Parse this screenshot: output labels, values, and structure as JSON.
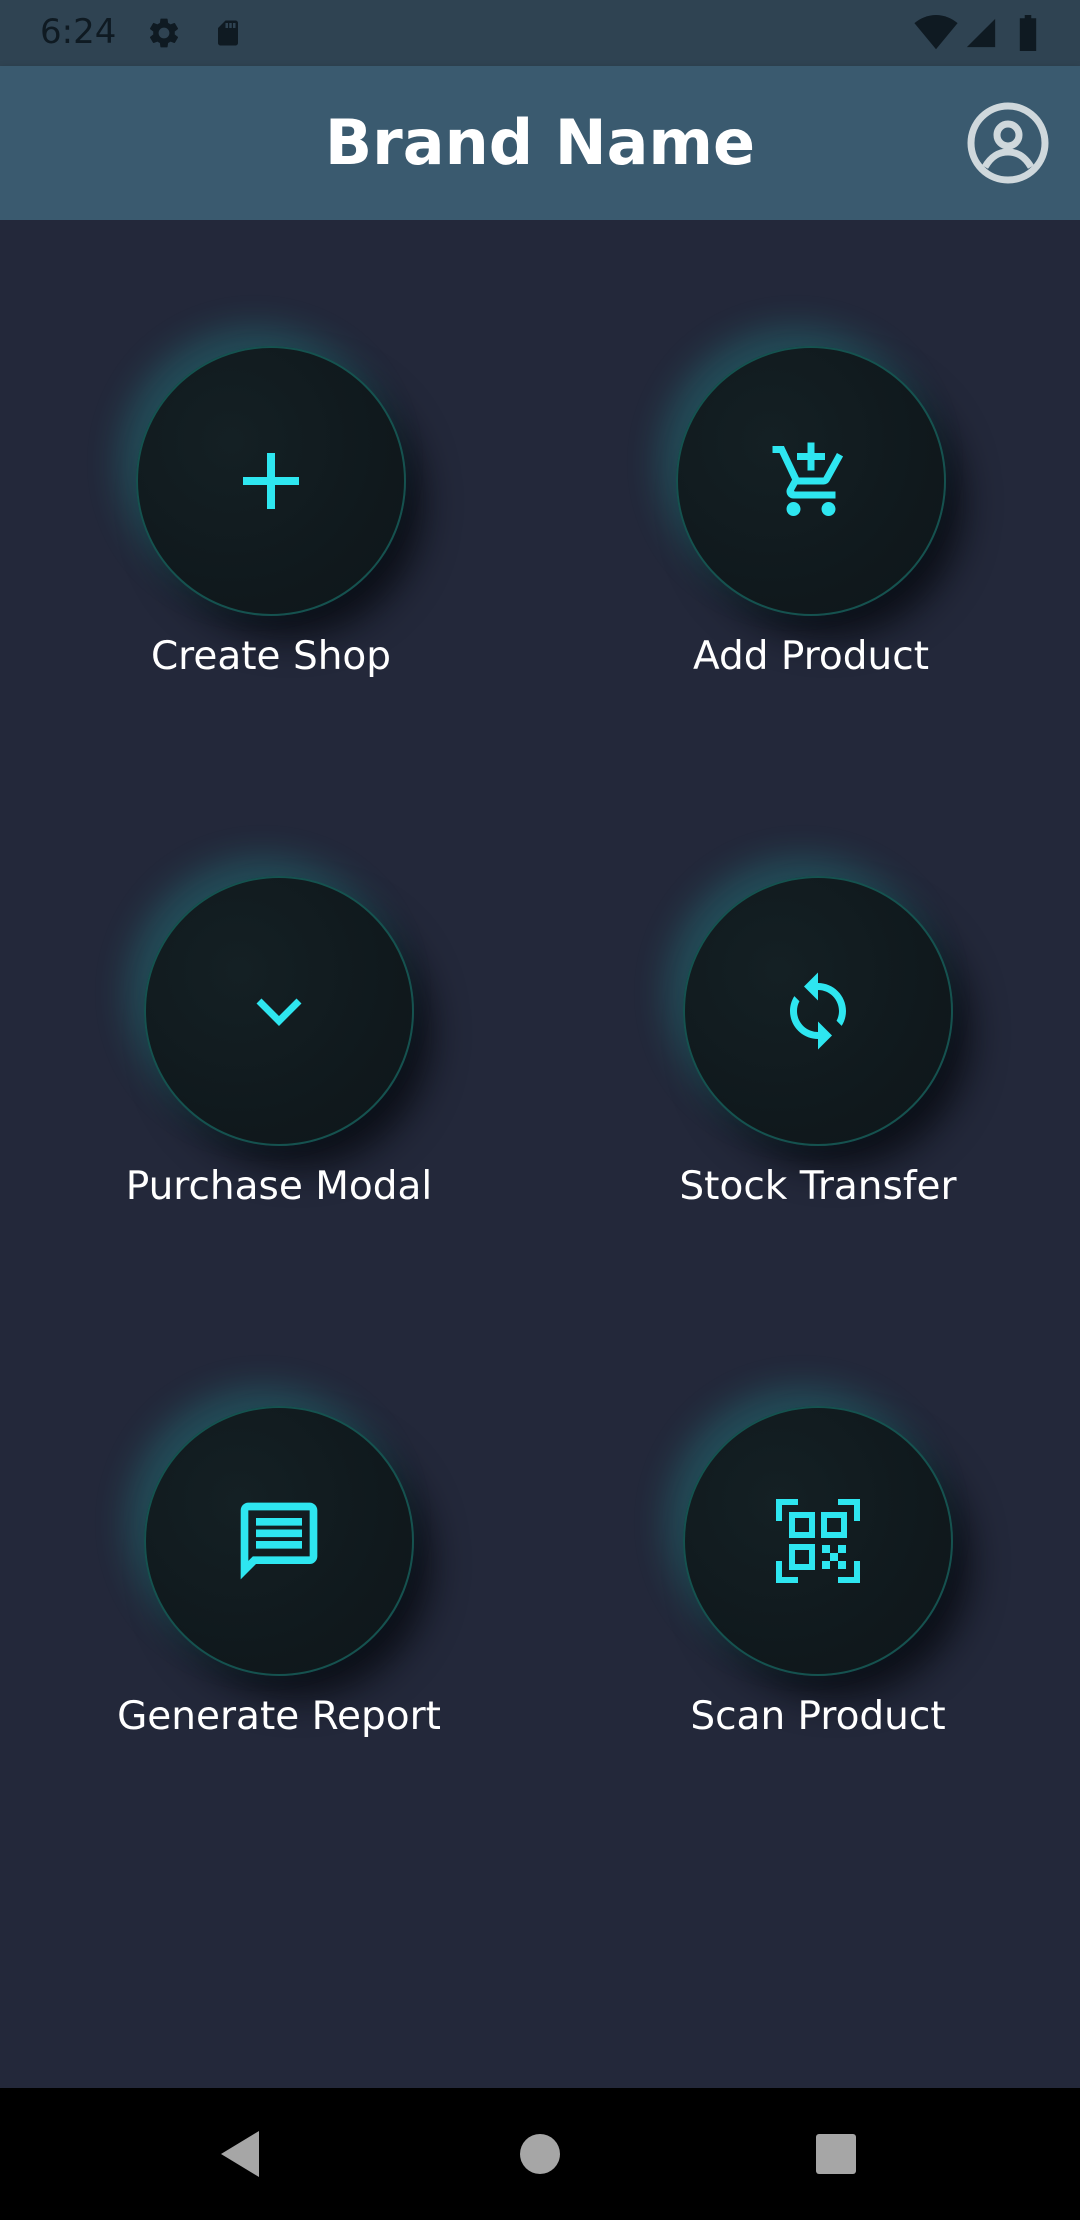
{
  "status_bar": {
    "time": "6:24",
    "icons": [
      "settings-icon",
      "sd-card-icon",
      "wifi-icon",
      "signal-icon",
      "battery-icon"
    ]
  },
  "app_bar": {
    "title": "Brand Name",
    "profile_icon": "account-circle-icon"
  },
  "colors": {
    "accent": "#2ee6f0",
    "background": "#23283a",
    "app_bar": "#3a5a6f",
    "status_bar": "#2f4352"
  },
  "actions": [
    {
      "label": "Create Shop",
      "icon": "plus-icon"
    },
    {
      "label": "Add Product",
      "icon": "add-to-cart-icon"
    },
    {
      "label": "Purchase Modal",
      "icon": "chevron-down-icon"
    },
    {
      "label": "Stock Transfer",
      "icon": "sync-icon"
    },
    {
      "label": "Generate Report",
      "icon": "message-report-icon"
    },
    {
      "label": "Scan Product",
      "icon": "qr-scan-icon"
    }
  ],
  "nav_bar": {
    "icons": [
      "back-icon",
      "home-icon",
      "recents-icon"
    ]
  }
}
